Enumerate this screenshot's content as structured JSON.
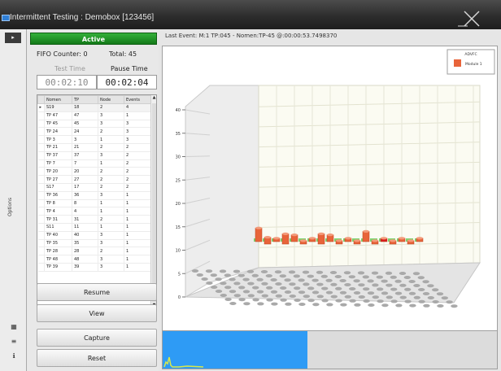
{
  "window": {
    "title": "Intermittent Testing : Demobox [123456]",
    "icon": "app-window-icon"
  },
  "sidebar": {
    "label": "Options",
    "tools": [
      "grid-icon",
      "list-icon",
      "info-icon"
    ]
  },
  "panel": {
    "status_label": "Active",
    "fifo_counter": "FIFO Counter: 0",
    "total": "Total: 45",
    "test_time_label": "Test Time",
    "test_time": "00:02:10",
    "pause_time_label": "Pause Time",
    "pause_time": "00:02:04",
    "columns": [
      "Nomen",
      "TP",
      "Node",
      "Events"
    ],
    "rows": [
      [
        "S19",
        "18",
        "2",
        "4"
      ],
      [
        "TP 47",
        "47",
        "3",
        "1"
      ],
      [
        "TP 45",
        "45",
        "3",
        "3"
      ],
      [
        "TP 24",
        "24",
        "2",
        "3"
      ],
      [
        "TP 3",
        "3",
        "1",
        "3"
      ],
      [
        "TP 21",
        "21",
        "2",
        "2"
      ],
      [
        "TP 37",
        "37",
        "3",
        "2"
      ],
      [
        "TP 7",
        "7",
        "1",
        "2"
      ],
      [
        "TP 20",
        "20",
        "2",
        "2"
      ],
      [
        "TP 27",
        "27",
        "2",
        "2"
      ],
      [
        "S17",
        "17",
        "2",
        "2"
      ],
      [
        "TP 36",
        "36",
        "3",
        "1"
      ],
      [
        "TP 8",
        "8",
        "1",
        "1"
      ],
      [
        "TP 4",
        "4",
        "1",
        "1"
      ],
      [
        "TP 31",
        "31",
        "2",
        "1"
      ],
      [
        "S11",
        "11",
        "1",
        "1"
      ],
      [
        "TP 40",
        "40",
        "3",
        "1"
      ],
      [
        "TP 35",
        "35",
        "3",
        "1"
      ],
      [
        "TP 28",
        "28",
        "2",
        "1"
      ],
      [
        "TP 48",
        "48",
        "3",
        "1"
      ],
      [
        "TP 39",
        "39",
        "3",
        "1"
      ]
    ],
    "buttons": {
      "resume": "Resume",
      "view": "View",
      "capture": "Capture",
      "reset": "Reset"
    }
  },
  "main": {
    "last_event": "Last Event:   M:1 TP:045 - Nomen:TP-45  @:00:00:53.7498370"
  },
  "chart_data": {
    "type": "bar",
    "title": "",
    "xlabel": "",
    "ylabel": "",
    "ylim": [
      0,
      40
    ],
    "yticks": [
      0,
      5,
      10,
      15,
      20,
      25,
      30,
      35,
      40
    ],
    "legend": {
      "title": "ADVFC",
      "entries": [
        "Module 1"
      ],
      "placement": "top-right"
    },
    "series": [
      {
        "name": "Module 1",
        "values": [
          4,
          2,
          1,
          3,
          2,
          1,
          1,
          3,
          2,
          1,
          1,
          1,
          3,
          1,
          1,
          1,
          1,
          1,
          1
        ]
      }
    ],
    "colors": {
      "bar": "#e8643a",
      "highlight": "#d81b1b",
      "floor_base": "#7ed36f",
      "peg": "#a9a9a9"
    }
  }
}
